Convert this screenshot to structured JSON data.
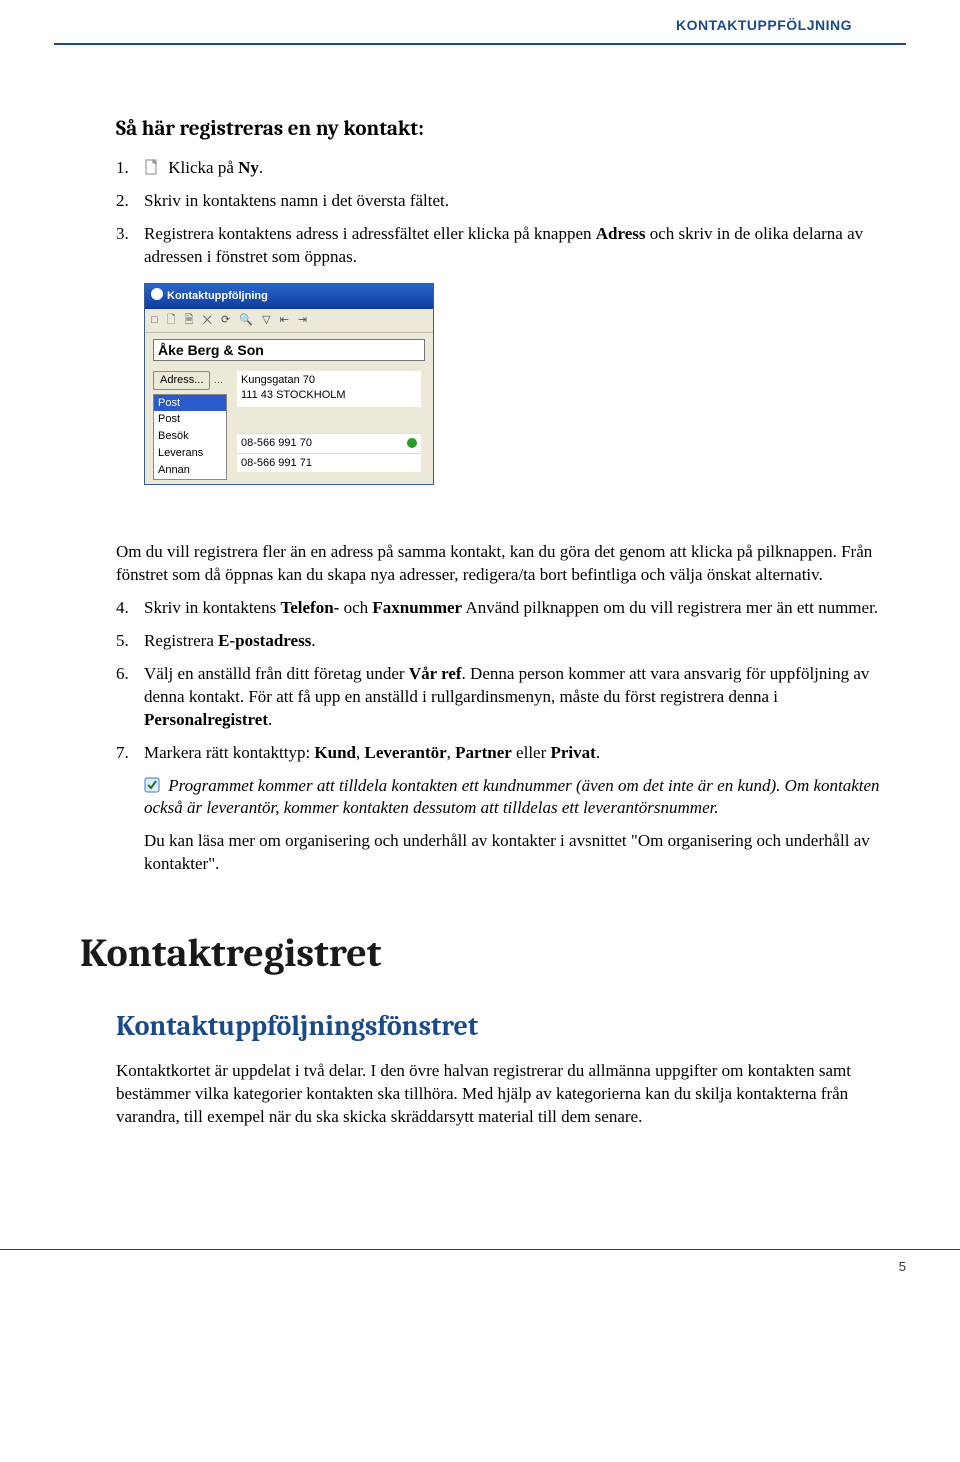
{
  "header": {
    "running_title": "KONTAKTUPPFÖLJNING"
  },
  "section1": {
    "title": "Så här registreras en ny kontakt:",
    "step1_num": "1.",
    "step1_text": "Klicka på ",
    "step1_bold": "Ny",
    "step1_after": ".",
    "step2_num": "2.",
    "step2_text": "Skriv in kontaktens namn i det översta fältet.",
    "step3_num": "3.",
    "step3_a": "Registrera kontaktens adress i adressfältet eller klicka på knappen ",
    "step3_b": "Adress",
    "step3_c": " och skriv in de olika delarna av adressen i fönstret som öppnas.",
    "after_img_p1": "Om du vill registrera fler än en adress på samma kontakt, kan du göra det genom att klicka på pilknappen. Från fönstret som då öppnas kan du skapa nya adresser, redigera/ta bort befintliga och välja önskat alternativ.",
    "step4_num": "4.",
    "step4_a": "Skriv in kontaktens ",
    "step4_b": "Telefon-",
    "step4_c": " och ",
    "step4_d": "Faxnummer",
    "step4_e": " Använd pilknappen om du vill registrera mer än ett nummer.",
    "step5_num": "5.",
    "step5_a": "Registrera ",
    "step5_b": "E-postadress",
    "step5_c": ".",
    "step6_num": "6.",
    "step6_a": "Välj en anställd från ditt företag under ",
    "step6_b": "Vår ref",
    "step6_c": ". Denna person kommer att vara ansvarig för uppföljning av denna kontakt. För att få upp en anställd i rullgardinsmenyn, måste du först registrera denna i ",
    "step6_d": "Personalregistret",
    "step6_e": ".",
    "step7_num": "7.",
    "step7_a": "Markera rätt kontakttyp: ",
    "step7_b": "Kund",
    "step7_c": ", ",
    "step7_d": "Leverantör",
    "step7_e": ", ",
    "step7_f": "Partner",
    "step7_g": " eller ",
    "step7_h": "Privat",
    "step7_i": ".",
    "note_text": "Programmet kommer att tilldela kontakten ett kundnummer (även om det inte är en kund). Om kontakten också är leverantör, kommer kontakten dessutom att tilldelas ett leverantörsnummer.",
    "closing": "Du kan läsa mer om organisering och underhåll av kontakter i avsnittet \"Om organisering och underhåll av kontakter\"."
  },
  "screenshot": {
    "window_title": "Kontaktuppföljning",
    "toolbar_glyphs": "□ 🗋 🗎 ✕ ⟳ 🔍 ▽ ⇤ ⇥",
    "name_value": "Åke Berg & Son",
    "address_button": "Adress...",
    "list": {
      "post_sel": "Post",
      "post": "Post",
      "besok": "Besök",
      "leverans": "Leverans",
      "annan": "Annan"
    },
    "address_line1": "Kungsgatan 70",
    "address_line2": "111 43 STOCKHOLM",
    "phone1": "08-566 991 70",
    "phone2": "08-566 991 71"
  },
  "section2": {
    "h1": "Kontaktregistret",
    "h2": "Kontaktuppföljningsfönstret",
    "para": "Kontaktkortet är uppdelat i två delar. I den övre halvan registrerar du allmänna uppgifter om kontakten samt bestämmer vilka kategorier kontakten ska tillhöra. Med hjälp av kategorierna kan du skilja kontakterna från varandra, till exempel när du ska skicka skräddarsytt material till dem senare."
  },
  "footer": {
    "page_number": "5"
  }
}
